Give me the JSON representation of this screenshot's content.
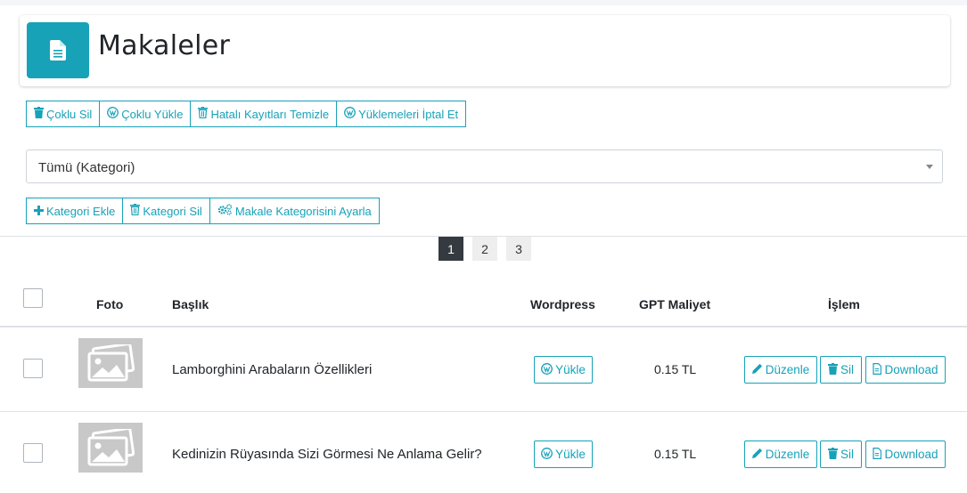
{
  "page": {
    "title": "Makaleler",
    "header_icon": "document-icon"
  },
  "toolbar": [
    {
      "label": "Çoklu Sil",
      "icon": "trash-icon"
    },
    {
      "label": "Çoklu Yükle",
      "icon": "wordpress-icon"
    },
    {
      "label": "Hatalı Kayıtları Temizle",
      "icon": "trash-outline-icon"
    },
    {
      "label": "Yüklemeleri İptal Et",
      "icon": "wordpress-icon"
    }
  ],
  "category_select": {
    "value": "Tümü (Kategori)"
  },
  "category_toolbar": [
    {
      "label": "Kategori Ekle",
      "icon": "plus-icon"
    },
    {
      "label": "Kategori Sil",
      "icon": "trash-outline-icon"
    },
    {
      "label": "Makale Kategorisini Ayarla",
      "icon": "gears-icon"
    }
  ],
  "pagination": {
    "pages": [
      "1",
      "2",
      "3"
    ],
    "active": "1"
  },
  "table": {
    "headers": {
      "photo": "Foto",
      "title": "Başlık",
      "wordpress": "Wordpress",
      "gpt_cost": "GPT Maliyet",
      "action": "İşlem"
    },
    "rows": [
      {
        "title": "Lamborghini Arabaların Özellikleri",
        "wordpress": "Yükle",
        "gpt_cost": "0.15 TL",
        "edit": "Düzenle",
        "delete": "Sil",
        "download": "Download"
      },
      {
        "title": "Kedinizin Rüyasında Sizi Görmesi Ne Anlama Gelir?",
        "wordpress": "Yükle",
        "gpt_cost": "0.15 TL",
        "edit": "Düzenle",
        "delete": "Sil",
        "download": "Download"
      }
    ]
  },
  "colors": {
    "accent": "#17a2b8",
    "active_page": "#343a40",
    "thumb": "#c8c8c8"
  }
}
